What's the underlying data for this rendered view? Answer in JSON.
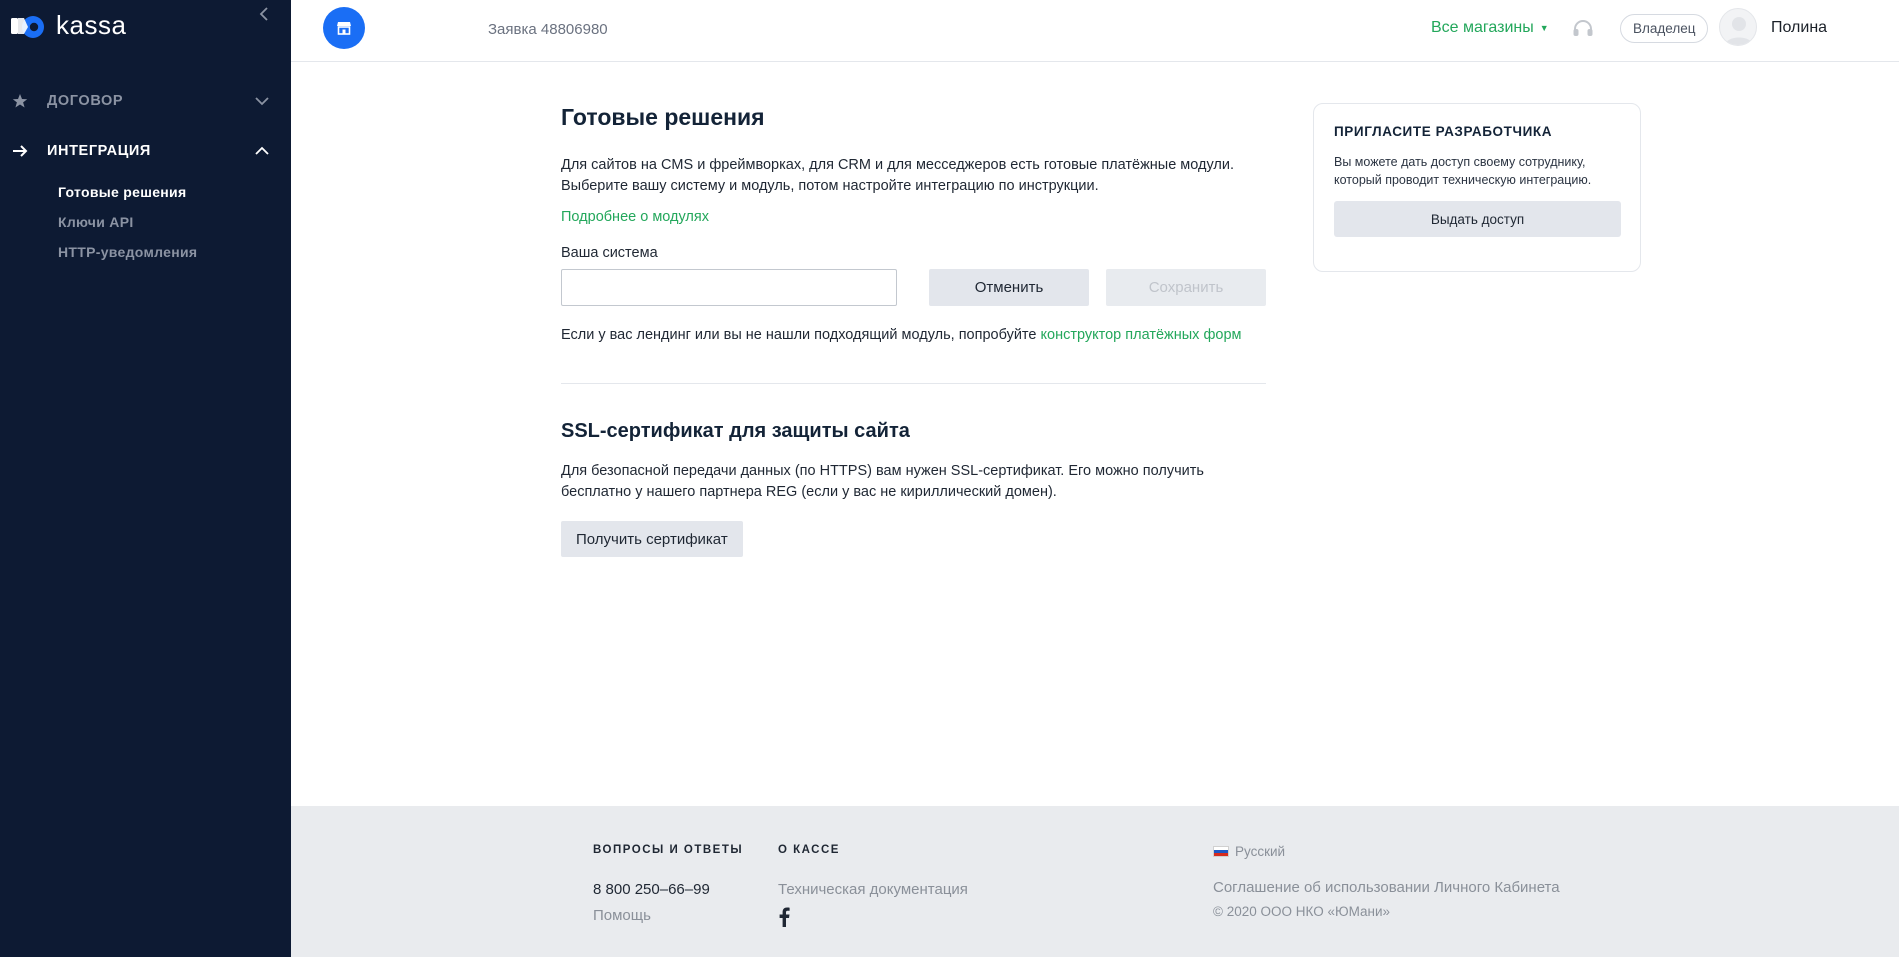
{
  "sidebar": {
    "logo_text": "kassa",
    "collapse_icon": "chevron-left-icon",
    "sections": [
      {
        "label": "Договор",
        "icon": "star-icon",
        "expanded": false
      },
      {
        "label": "Интеграция",
        "icon": "arrow-right-icon",
        "expanded": true
      }
    ],
    "sub_items": [
      {
        "label": "Готовые решения",
        "active": true
      },
      {
        "label": "Ключи API",
        "active": false
      },
      {
        "label": "HTTP-уведомления",
        "active": false
      }
    ]
  },
  "header": {
    "order_number": "Заявка 48806980",
    "stores_label": "Все магазины",
    "role_label": "Владелец",
    "user_name": "Полина"
  },
  "main": {
    "title": "Готовые решения",
    "intro": "Для сайтов на CMS и фреймворках, для CRM и для месседжеров есть готовые платёжные модули. Выберите вашу систему и модуль, потом настройте интеграцию по инструкции.",
    "more_link": "Подробнее о модулях",
    "system_label": "Ваша система",
    "system_value": "",
    "cancel_label": "Отменить",
    "save_label": "Сохранить",
    "landing_text": "Если у вас лендинг или вы не нашли подходящий модуль, попробуйте",
    "landing_link": "конструктор платёжных форм",
    "ssl_title": "SSL-сертификат для защиты сайта",
    "ssl_text": "Для безопасной передачи данных (по HTTPS) вам нужен SSL-сертификат. Его можно получить бесплатно у нашего партнера REG (если у вас не кириллический домен).",
    "cert_button": "Получить сертификат"
  },
  "invite_card": {
    "title": "Пригласите разработчика",
    "text": "Вы можете дать доступ своему сотруднику, который проводит техническую интеграцию.",
    "button": "Выдать доступ"
  },
  "footer": {
    "faq_head": "Вопросы и ответы",
    "phone": "8 800 250–66–99",
    "help": "Помощь",
    "about_head": "О кассе",
    "tech_docs": "Техническая документация",
    "language": "Русский",
    "agreement": "Соглашение об использовании Личного Кабинета",
    "copyright": "© 2020  ООО НКО «ЮМани»"
  },
  "colors": {
    "sidebar_bg": "#0d1a33",
    "accent_green": "#23a75b",
    "accent_blue": "#1a6ef5",
    "footer_bg": "#e9ebee"
  }
}
